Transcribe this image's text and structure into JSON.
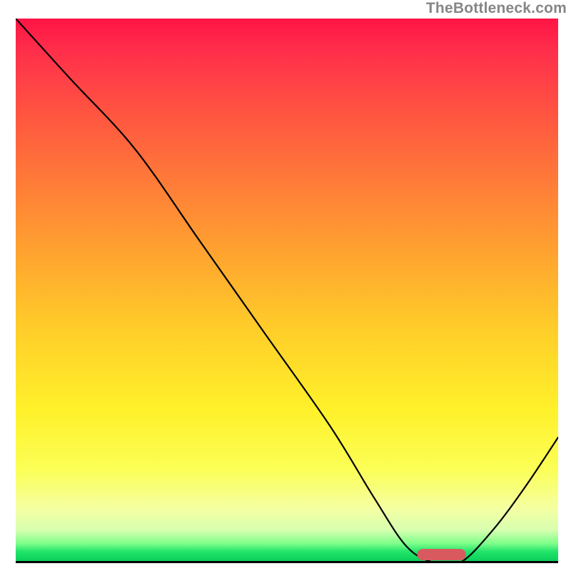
{
  "watermark": "TheBottleneck.com",
  "colors": {
    "curve": "#000000",
    "marker": "#d85a5f",
    "axis": "#000000"
  },
  "chart_data": {
    "type": "line",
    "title": "",
    "xlabel": "",
    "ylabel": "",
    "x_range": [
      0,
      100
    ],
    "y_range": [
      0,
      100
    ],
    "grid": false,
    "legend": false,
    "series": [
      {
        "name": "bottleneck-curve",
        "x": [
          0,
          10,
          22,
          34,
          46,
          58,
          66,
          72,
          77,
          82,
          88,
          94,
          100
        ],
        "y": [
          100,
          89,
          76,
          59,
          42,
          25,
          12,
          3,
          0,
          0,
          6,
          14,
          23
        ]
      }
    ],
    "marker": {
      "name": "optimal-range",
      "x_start": 74,
      "x_end": 83,
      "y": 0.4,
      "height": 2.1
    },
    "gradient_stops": [
      {
        "pos": 0,
        "color": "#ff1445"
      },
      {
        "pos": 0.3,
        "color": "#ff7b38"
      },
      {
        "pos": 0.58,
        "color": "#ffd029"
      },
      {
        "pos": 0.83,
        "color": "#fbff57"
      },
      {
        "pos": 0.96,
        "color": "#7fff8b"
      },
      {
        "pos": 1.0,
        "color": "#06cc57"
      }
    ]
  }
}
